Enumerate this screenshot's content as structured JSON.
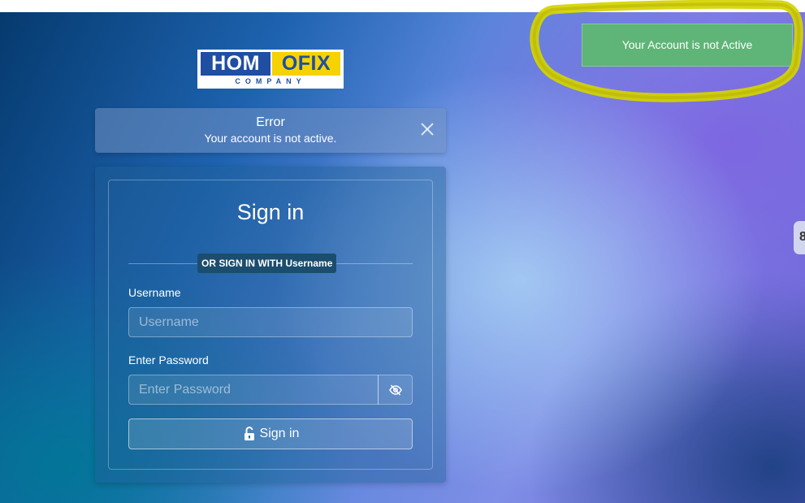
{
  "logo": {
    "left_text": "HOM",
    "right_text": "OFIX",
    "sub_text": "COMPANY",
    "colors": {
      "blue": "#1f4ea3",
      "yellow": "#f5d200"
    }
  },
  "alert": {
    "title": "Error",
    "message": "Your account is not active.",
    "close_icon": "close-icon"
  },
  "login": {
    "title": "Sign in",
    "divider_label": "OR SIGN IN WITH Username",
    "username": {
      "label": "Username",
      "placeholder": "Username",
      "value": ""
    },
    "password": {
      "label": "Enter Password",
      "placeholder": "Enter Password",
      "value": "",
      "toggle_icon": "eye-slash-icon"
    },
    "submit": {
      "label": "Sign in",
      "icon": "unlock-icon"
    }
  },
  "toast": {
    "message": "Your Account is not Active",
    "color": "#5fb477"
  },
  "annotation": {
    "color": "#d4d400"
  },
  "side_tab": {
    "glyph": "8"
  }
}
